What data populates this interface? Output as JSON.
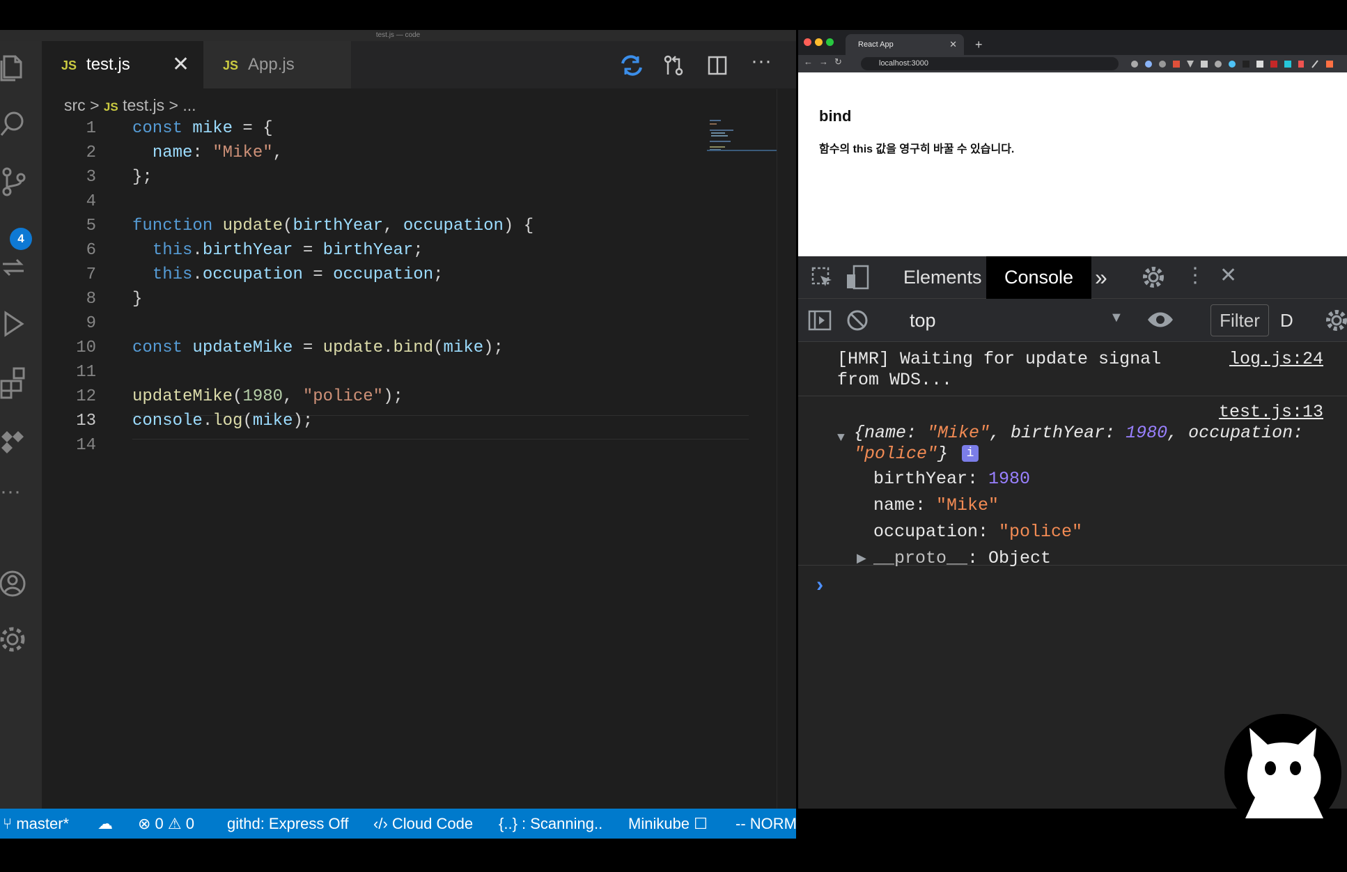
{
  "editor": {
    "window_title": "test.js — code",
    "tabs": [
      {
        "icon_text": "JS",
        "label": "test.js"
      },
      {
        "icon_text": "JS",
        "label": "App.js"
      }
    ],
    "close_glyph": "✕",
    "scm_badge": "4",
    "breadcrumb": {
      "folder": "src",
      "sep": ">",
      "icon_text": "JS",
      "file": "test.js",
      "tail": "..."
    },
    "line_numbers": [
      "1",
      "2",
      "3",
      "4",
      "5",
      "6",
      "7",
      "8",
      "9",
      "10",
      "11",
      "12",
      "13",
      "14"
    ],
    "code_lines": [
      "const mike = {",
      "  name: \"Mike\",",
      "};",
      "",
      "function update(birthYear, occupation) {",
      "  this.birthYear = birthYear;",
      "  this.occupation = occupation;",
      "}",
      "",
      "const updateMike = update.bind(mike);",
      "",
      "updateMike(1980, \"police\");",
      "console.log(mike);",
      ""
    ]
  },
  "statusbar": {
    "branch": "master*",
    "errors": "0",
    "warnings": "0",
    "githd": "githd: Express Off",
    "cloud_code": "Cloud Code",
    "scanning": "{..} : Scanning..",
    "minikube": "Minikube",
    "mode": "-- NORM"
  },
  "browser": {
    "tab_title": "React App",
    "tab_close": "✕",
    "new_tab": "+",
    "url": "localhost:3000",
    "page_heading": "bind",
    "page_text": "함수의 this 값을 영구히 바꿀 수 있습니다."
  },
  "devtools": {
    "tabs": {
      "elements": "Elements",
      "console": "Console",
      "more": "»"
    },
    "context": "top",
    "filter": "Filter",
    "levels": "D",
    "messages": {
      "hmr_line1": "[HMR] Waiting for update signal",
      "hmr_line2": "from WDS...",
      "hmr_source": "log.js:24",
      "log_source": "test.js:13",
      "obj_line1_open": "{name: ",
      "obj_name_val": "\"Mike\"",
      "obj_birth_key": ", birthYear: ",
      "obj_birth_val": "1980",
      "obj_occ_key": ", occupation:",
      "obj_line2_val": "\"police\"",
      "obj_line2_close": "}",
      "info_badge": "i",
      "prop_birth_key": "birthYear: ",
      "prop_birth_val": "1980",
      "prop_name_key": "name: ",
      "prop_name_val": "\"Mike\"",
      "prop_occ_key": "occupation: ",
      "prop_occ_val": "\"police\"",
      "proto_key": "__proto__",
      "proto_sep": ": ",
      "proto_val": "Object",
      "prompt": "›"
    }
  },
  "colors": {
    "accent": "#007acc",
    "keyword": "#569cd6",
    "string": "#ce9178",
    "function": "#dcdcaa",
    "number": "#b5cea8",
    "console_string": "#f28b54",
    "console_number": "#9980ff"
  }
}
